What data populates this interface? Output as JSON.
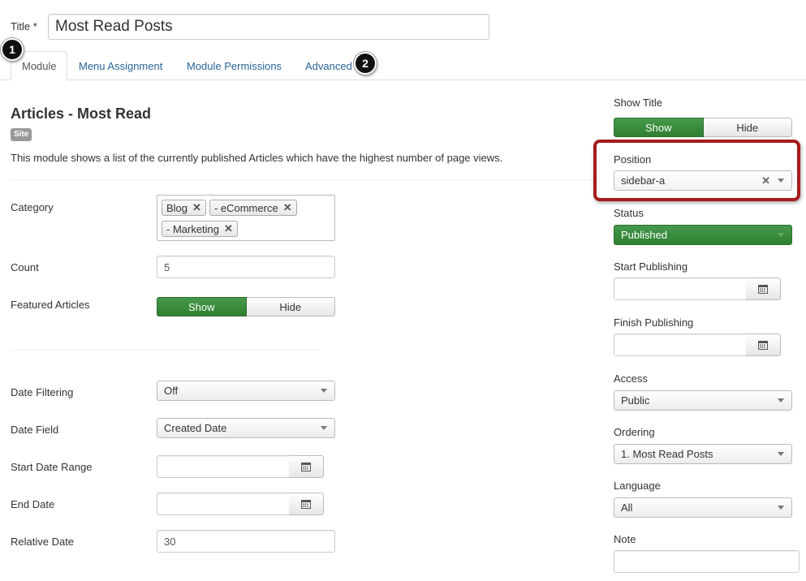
{
  "title_field": {
    "label": "Title *",
    "value": "Most Read Posts"
  },
  "tabs": [
    {
      "label": "Module"
    },
    {
      "label": "Menu Assignment"
    },
    {
      "label": "Module Permissions"
    },
    {
      "label": "Advanced"
    }
  ],
  "markers": [
    "1",
    "2"
  ],
  "module": {
    "heading": "Articles - Most Read",
    "badge": "Site",
    "description": "This module shows a list of the currently published Articles which have the highest number of page views."
  },
  "form": {
    "category": {
      "label": "Category",
      "tags": [
        "Blog",
        "- eCommerce",
        "- Marketing"
      ]
    },
    "count": {
      "label": "Count",
      "value": "5"
    },
    "featured": {
      "label": "Featured Articles",
      "show": "Show",
      "hide": "Hide",
      "selected": "Show"
    },
    "date_filtering": {
      "label": "Date Filtering",
      "value": "Off"
    },
    "date_field": {
      "label": "Date Field",
      "value": "Created Date"
    },
    "start_date_range": {
      "label": "Start Date Range",
      "value": ""
    },
    "end_date": {
      "label": "End Date",
      "value": ""
    },
    "relative_date": {
      "label": "Relative Date",
      "value": "30"
    }
  },
  "sidebar": {
    "show_title": {
      "label": "Show Title",
      "show": "Show",
      "hide": "Hide",
      "selected": "Show"
    },
    "position": {
      "label": "Position",
      "value": "sidebar-a"
    },
    "status": {
      "label": "Status",
      "value": "Published"
    },
    "start_publishing": {
      "label": "Start Publishing",
      "value": ""
    },
    "finish_publishing": {
      "label": "Finish Publishing",
      "value": ""
    },
    "access": {
      "label": "Access",
      "value": "Public"
    },
    "ordering": {
      "label": "Ordering",
      "value": "1. Most Read Posts"
    },
    "language": {
      "label": "Language",
      "value": "All"
    },
    "note": {
      "label": "Note",
      "value": ""
    }
  },
  "icons": {
    "calendar": "calendar-icon",
    "clear": "clear-icon",
    "tag_remove": "remove-tag-icon"
  },
  "colors": {
    "green": "#3b8a3b",
    "link": "#2a6496",
    "highlight": "#a51c1c"
  }
}
